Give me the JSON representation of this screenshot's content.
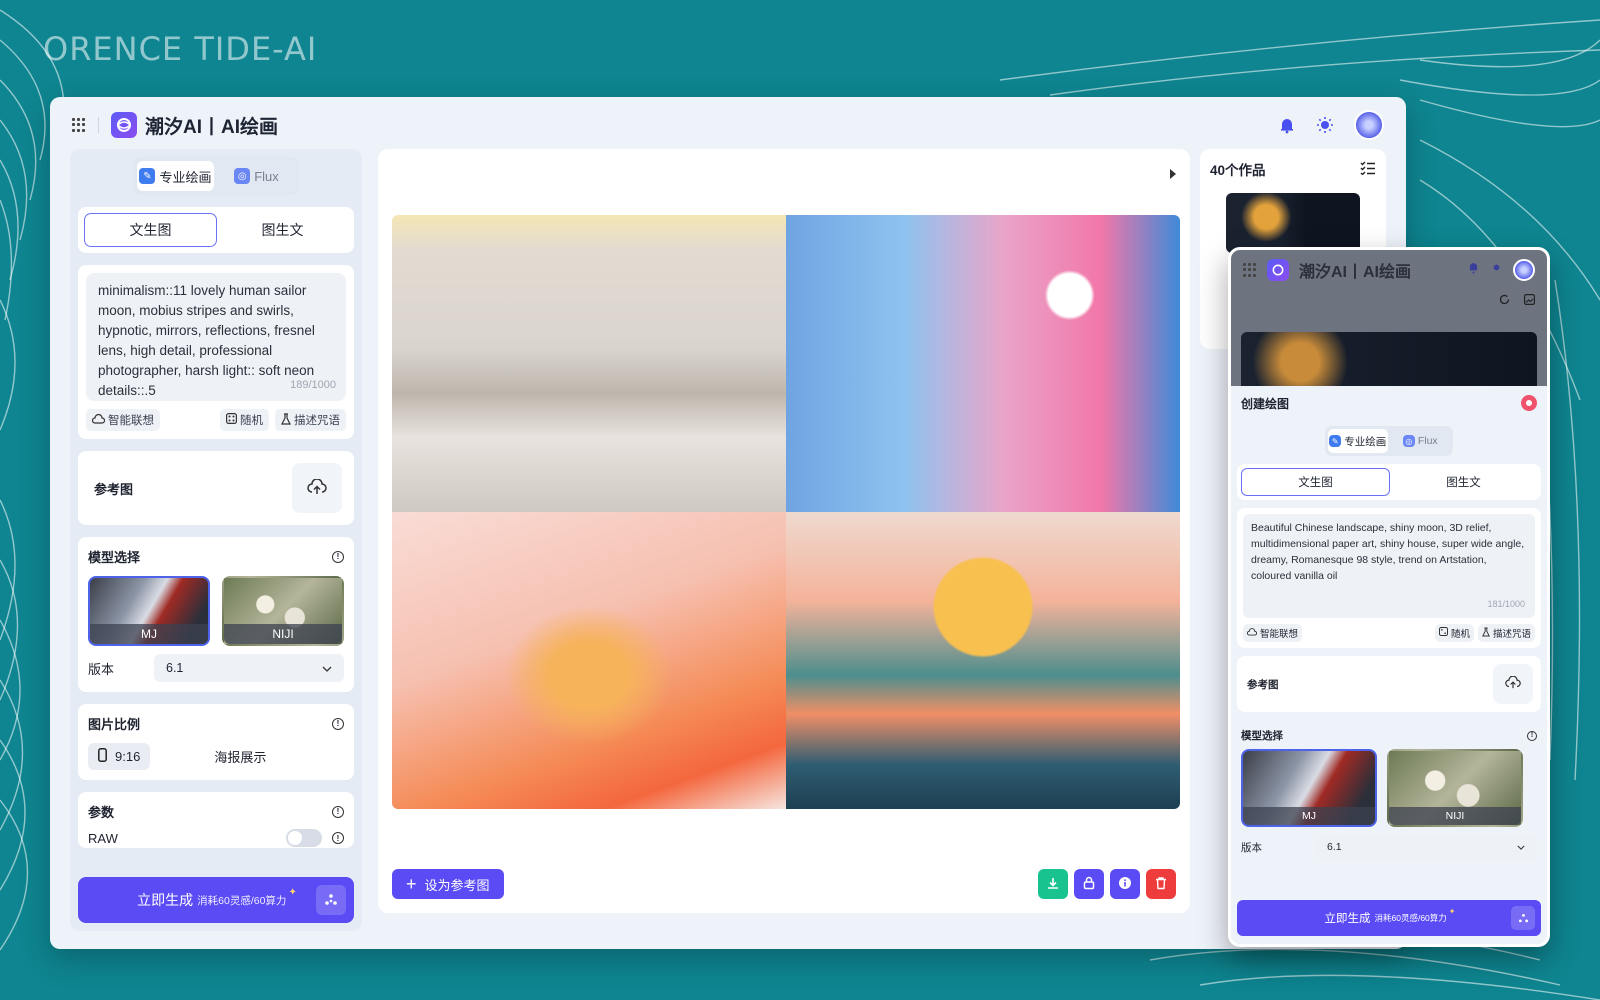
{
  "watermark": "ORENCE TIDE-AI",
  "app": {
    "title": "潮汐AI丨AI绘画"
  },
  "left": {
    "mode_tabs": [
      {
        "label": "专业绘画",
        "icon": "paint-icon",
        "active": true
      },
      {
        "label": "Flux",
        "icon": "flux-icon",
        "active": false
      }
    ],
    "sub_tabs": [
      {
        "label": "文生图",
        "active": true
      },
      {
        "label": "图生文",
        "active": false
      }
    ],
    "prompt": "minimalism::11 lovely human sailor moon, mobius stripes and swirls, hypnotic, mirrors, reflections, fresnel lens, high detail, professional photographer, harsh light:: soft neon details::.5",
    "prompt_counter": "189/1000",
    "tools": {
      "smart": "智能联想",
      "random": "随机",
      "describe": "描述咒语"
    },
    "reference": "参考图",
    "model_section": "模型选择",
    "models": [
      {
        "label": "MJ",
        "selected": true
      },
      {
        "label": "NIJI",
        "selected": false
      }
    ],
    "version_label": "版本",
    "version_value": "6.1",
    "ratio_section": "图片比例",
    "ratio_value": "9:16",
    "ratio_option": "海报展示",
    "params_section": "参数",
    "raw_label": "RAW",
    "generate": {
      "main": "立即生成",
      "sub": "消耗60灵感/60算力"
    }
  },
  "center": {
    "set_ref_button": "设为参考图"
  },
  "right": {
    "works_title": "40个作品"
  },
  "mobile": {
    "title": "潮汐AI丨AI绘画",
    "sheet_title": "创建绘图",
    "mode_tabs": [
      {
        "label": "专业绘画"
      },
      {
        "label": "Flux"
      }
    ],
    "sub_tabs": [
      {
        "label": "文生图"
      },
      {
        "label": "图生文"
      }
    ],
    "prompt": "Beautiful Chinese landscape, shiny moon, 3D relief, multidimensional paper art, shiny house, super wide angle, dreamy, Romanesque 98 style, trend on Artstation, coloured vanilla oil",
    "prompt_counter": "181/1000",
    "tools": {
      "smart": "智能联想",
      "random": "随机",
      "describe": "描述咒语"
    },
    "reference": "参考图",
    "model_section": "模型选择",
    "models": [
      {
        "label": "MJ"
      },
      {
        "label": "NIJI"
      }
    ],
    "version_label": "版本",
    "version_value": "6.1",
    "generate": {
      "main": "立即生成",
      "sub": "消耗60灵感/60算力"
    }
  },
  "colors": {
    "background": "#0e8590",
    "accent": "#5b4bf5",
    "download": "#18c38f",
    "delete": "#ee3b3b"
  }
}
